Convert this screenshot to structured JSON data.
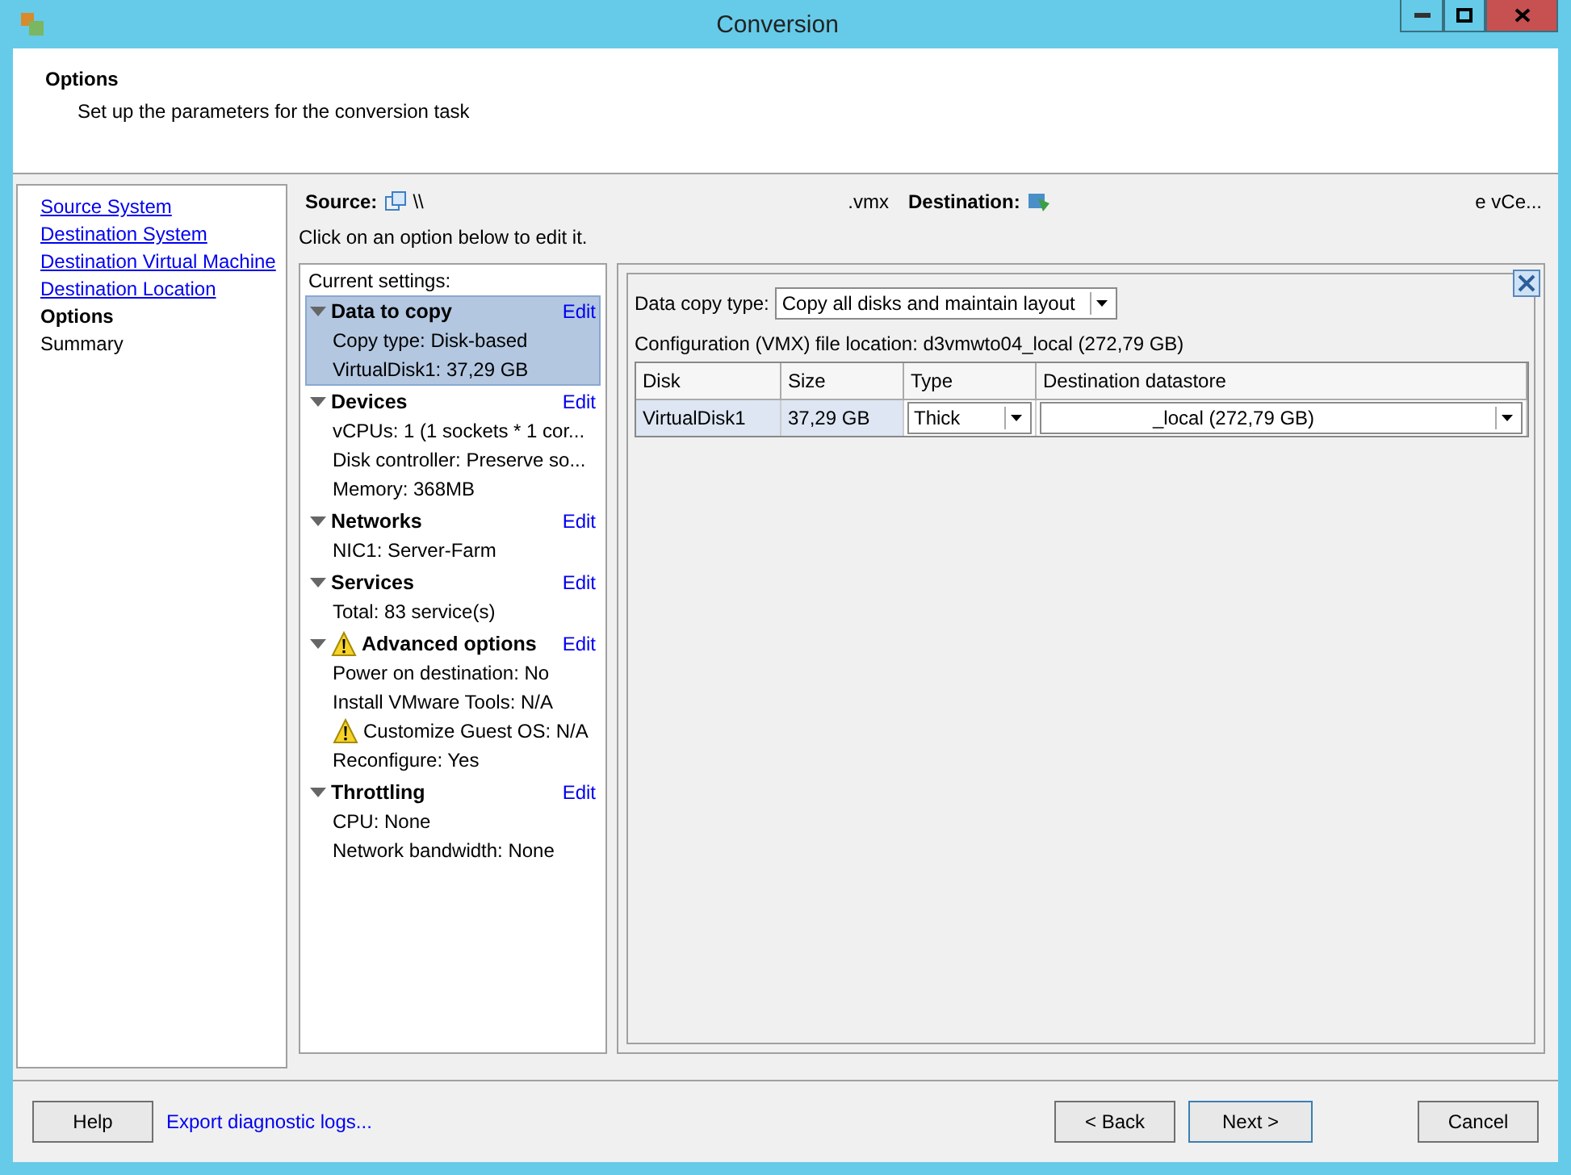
{
  "window": {
    "title": "Conversion"
  },
  "header": {
    "title": "Options",
    "subtitle": "Set up the parameters for the conversion task"
  },
  "nav": [
    {
      "label": "Source System",
      "kind": "link"
    },
    {
      "label": "Destination System",
      "kind": "link"
    },
    {
      "label": "Destination Virtual Machine",
      "kind": "link"
    },
    {
      "label": "Destination Location",
      "kind": "link"
    },
    {
      "label": "Options",
      "kind": "current"
    },
    {
      "label": "Summary",
      "kind": "pending"
    }
  ],
  "summary": {
    "source_label": "Source:",
    "source_path": "\\\\",
    "source_ext": ".vmx",
    "destination_label": "Destination:",
    "destination_text": "e vCe..."
  },
  "hint": "Click on an option below to edit it.",
  "settings": {
    "title": "Current settings:",
    "groups": [
      {
        "title": "Data to copy",
        "edit": "Edit",
        "selected": true,
        "warning": false,
        "expanded": true,
        "items": [
          {
            "text": "Copy type: Disk-based",
            "warning": false
          },
          {
            "text": "VirtualDisk1: 37,29 GB",
            "warning": false
          }
        ]
      },
      {
        "title": "Devices",
        "edit": "Edit",
        "selected": false,
        "warning": false,
        "expanded": true,
        "items": [
          {
            "text": "vCPUs: 1 (1 sockets * 1 cor...",
            "warning": false
          },
          {
            "text": "Disk controller: Preserve so...",
            "warning": false
          },
          {
            "text": "Memory: 368MB",
            "warning": false
          }
        ]
      },
      {
        "title": "Networks",
        "edit": "Edit",
        "selected": false,
        "warning": false,
        "expanded": true,
        "items": [
          {
            "text": "NIC1: Server-Farm",
            "warning": false
          }
        ]
      },
      {
        "title": "Services",
        "edit": "Edit",
        "selected": false,
        "warning": false,
        "expanded": true,
        "items": [
          {
            "text": "Total: 83 service(s)",
            "warning": false
          }
        ]
      },
      {
        "title": "Advanced options",
        "edit": "Edit",
        "selected": false,
        "warning": true,
        "expanded": true,
        "items": [
          {
            "text": "Power on destination: No",
            "warning": false
          },
          {
            "text": "Install VMware Tools: N/A",
            "warning": false
          },
          {
            "text": "Customize Guest OS: N/A",
            "warning": true
          },
          {
            "text": "Reconfigure: Yes",
            "warning": false
          }
        ]
      },
      {
        "title": "Throttling",
        "edit": "Edit",
        "selected": false,
        "warning": false,
        "expanded": true,
        "items": [
          {
            "text": "CPU: None",
            "warning": false
          },
          {
            "text": "Network bandwidth: None",
            "warning": false
          }
        ]
      }
    ]
  },
  "editor": {
    "copy_type_label": "Data copy type:",
    "copy_type_value": "Copy all disks and maintain layout",
    "config_location": "Configuration (VMX) file location: d3vmwto04_local (272,79 GB)",
    "table": {
      "columns": [
        "Disk",
        "Size",
        "Type",
        "Destination datastore"
      ],
      "rows": [
        {
          "selected": true,
          "disk": "VirtualDisk1",
          "size": "37,29 GB",
          "type": "Thick",
          "datastore": "_local (272,79 GB)"
        }
      ]
    }
  },
  "buttons": {
    "help": "Help",
    "export": "Export diagnostic logs...",
    "back": "< Back",
    "next": "Next >",
    "cancel": "Cancel"
  }
}
